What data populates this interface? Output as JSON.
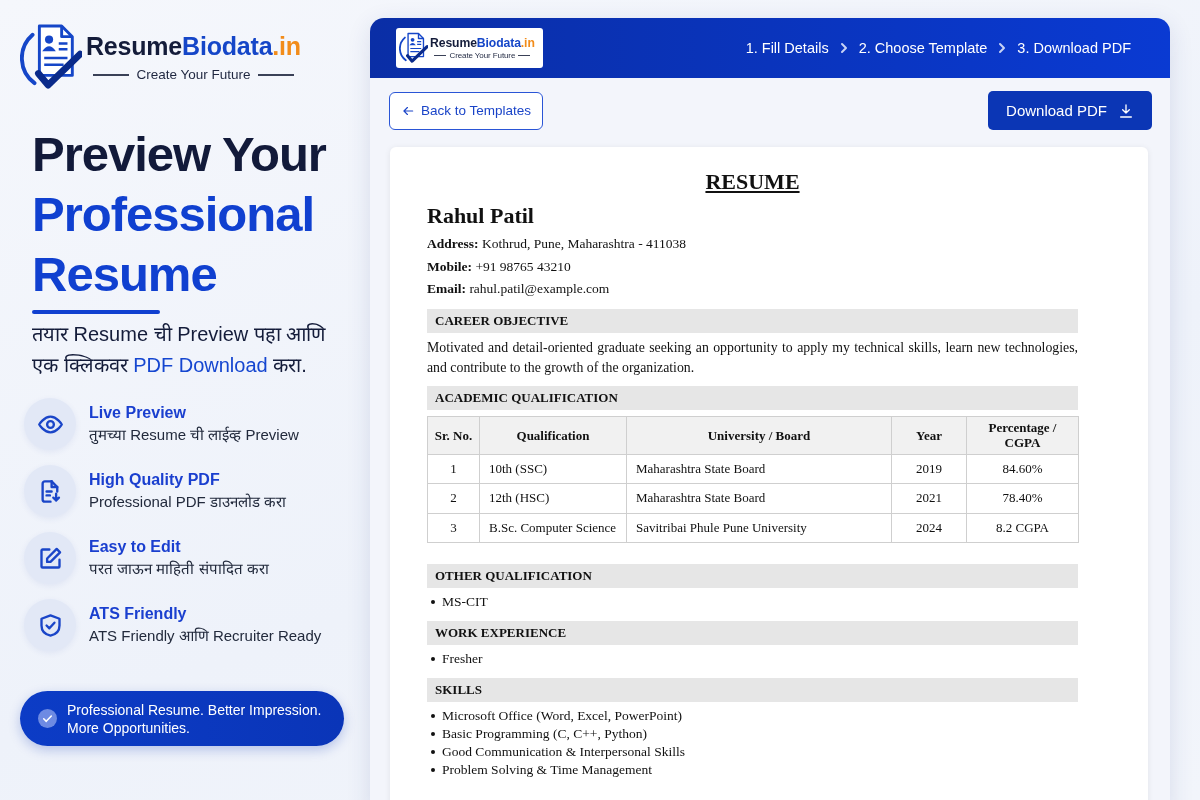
{
  "sidebar": {
    "logo": {
      "brand": [
        {
          "text": "Resume",
          "color": "#141c3a"
        },
        {
          "text": "Biodata",
          "color": "#1546c8"
        },
        {
          "text": ".in",
          "color": "#f28c1a"
        }
      ],
      "tagline": "Create Your Future"
    },
    "headline": [
      {
        "text": "Preview Your",
        "color": "#121a3a"
      },
      {
        "text": "Professional",
        "color": "#1040d0"
      },
      {
        "text": "Resume",
        "color": "#1040d0"
      }
    ],
    "subtitle": [
      {
        "text": "तयार Resume ची Preview पहा आणि एक क्लिकवर ",
        "highlight": false
      },
      {
        "text": "PDF Download",
        "highlight": true
      },
      {
        "text": " करा.",
        "highlight": false
      }
    ],
    "features": [
      {
        "title": "Live Preview",
        "description": "तुमच्या Resume ची लाईव्ह Preview"
      },
      {
        "title": "High Quality PDF",
        "description": "Professional PDF डाउनलोड करा"
      },
      {
        "title": "Easy to Edit",
        "description": "परत जाऊन माहिती संपादित करा"
      },
      {
        "title": "ATS Friendly",
        "description": "ATS Friendly आणि Recruiter Ready"
      }
    ],
    "banner": "Professional Resume. Better Impression. More Opportunities."
  },
  "header": {
    "logo": {
      "brand": [
        {
          "text": "Resume",
          "color": "#141c3a"
        },
        {
          "text": "Biodata",
          "color": "#1546c8"
        },
        {
          "text": ".in",
          "color": "#f28c1a"
        }
      ],
      "tagline": "Create Your Future"
    },
    "steps": [
      "1. Fill Details",
      "2. Choose Template",
      "3. Download PDF"
    ]
  },
  "toolbar": {
    "back_button": "Back to Templates",
    "download_button": "Download PDF"
  },
  "resume": {
    "title": "RESUME",
    "name": "Rahul Patil",
    "contact": [
      {
        "label": "Address:",
        "value": "Kothrud, Pune, Maharashtra - 411038"
      },
      {
        "label": "Mobile:",
        "value": "+91 98765 43210"
      },
      {
        "label": "Email:",
        "value": "rahul.patil@example.com"
      }
    ],
    "sections": [
      {
        "kind": "paragraph",
        "heading": "CAREER OBJECTIVE",
        "text": "Motivated and detail-oriented graduate seeking an opportunity to apply my technical skills, learn new technologies, and contribute to the growth of the organization."
      },
      {
        "kind": "table",
        "heading": "ACADEMIC QUALIFICATION",
        "columns": [
          "Sr. No.",
          "Qualification",
          "University / Board",
          "Year",
          "Percentage / CGPA"
        ],
        "rows": [
          [
            "1",
            "10th (SSC)",
            "Maharashtra State Board",
            "2019",
            "84.60%"
          ],
          [
            "2",
            "12th (HSC)",
            "Maharashtra State Board",
            "2021",
            "78.40%"
          ],
          [
            "3",
            "B.Sc. Computer Science",
            "Savitribai Phule Pune University",
            "2024",
            "8.2 CGPA"
          ]
        ]
      },
      {
        "kind": "list",
        "heading": "OTHER QUALIFICATION",
        "items": [
          "MS-CIT"
        ]
      },
      {
        "kind": "list",
        "heading": "WORK EXPERIENCE",
        "items": [
          "Fresher"
        ]
      },
      {
        "kind": "list",
        "heading": "SKILLS",
        "items": [
          "Microsoft Office (Word, Excel, PowerPoint)",
          "Basic Programming (C, C++, Python)",
          "Good Communication & Interpersonal Skills",
          "Problem Solving & Time Management"
        ]
      }
    ]
  }
}
